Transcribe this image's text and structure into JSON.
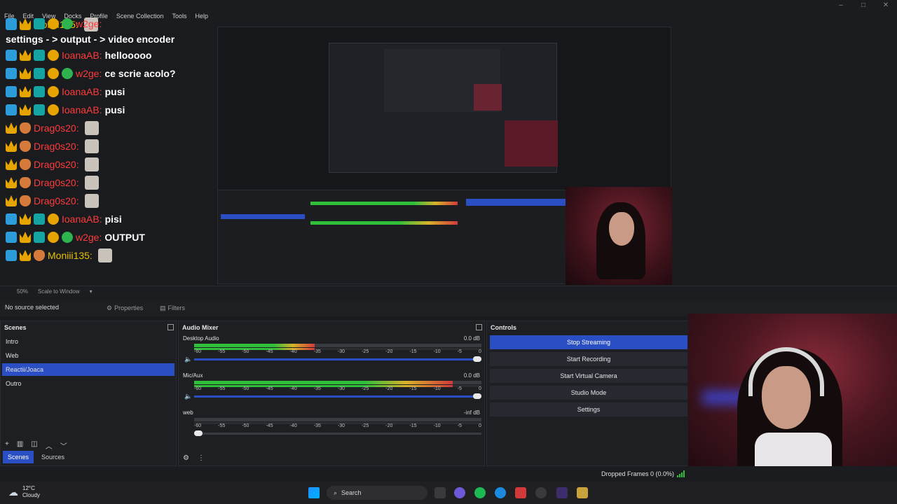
{
  "menu": [
    "File",
    "Edit",
    "View",
    "Docks",
    "Profile",
    "Scene Collection",
    "Tools",
    "Help"
  ],
  "chat": [
    {
      "user": "Moniii135:",
      "text": "",
      "color": "#e6c200",
      "badges": [
        "mod",
        "crown"
      ],
      "emote": true
    },
    {
      "user": "w2ge:",
      "text": "settings - > output - > video encoder",
      "color": "#ff3b3b",
      "badges": [
        "mod",
        "crown",
        "sub",
        "coin",
        "verify"
      ],
      "emote": false
    },
    {
      "user": "IoanaAB:",
      "text": "hellooooo",
      "color": "#ff3b3b",
      "badges": [
        "mod",
        "crown",
        "sub",
        "coin"
      ],
      "emote": false
    },
    {
      "user": "w2ge:",
      "text": "ce scrie acolo?",
      "color": "#ff3b3b",
      "badges": [
        "mod",
        "crown",
        "sub",
        "coin",
        "verify"
      ],
      "emote": false
    },
    {
      "user": "IoanaAB:",
      "text": "pusi",
      "color": "#ff3b3b",
      "badges": [
        "mod",
        "crown",
        "sub",
        "coin"
      ],
      "emote": false
    },
    {
      "user": "IoanaAB:",
      "text": "pusi",
      "color": "#ff3b3b",
      "badges": [
        "mod",
        "crown",
        "sub",
        "coin"
      ],
      "emote": false
    },
    {
      "user": "Drag0s20:",
      "text": "",
      "color": "#ff3b3b",
      "badges": [
        "crown",
        "cat"
      ],
      "emote": true
    },
    {
      "user": "Drag0s20:",
      "text": "",
      "color": "#ff3b3b",
      "badges": [
        "crown",
        "cat"
      ],
      "emote": true
    },
    {
      "user": "Drag0s20:",
      "text": "",
      "color": "#ff3b3b",
      "badges": [
        "crown",
        "cat"
      ],
      "emote": true
    },
    {
      "user": "Drag0s20:",
      "text": "",
      "color": "#ff3b3b",
      "badges": [
        "crown",
        "cat"
      ],
      "emote": true
    },
    {
      "user": "Drag0s20:",
      "text": "",
      "color": "#ff3b3b",
      "badges": [
        "crown",
        "cat"
      ],
      "emote": true
    },
    {
      "user": "IoanaAB:",
      "text": "pisi",
      "color": "#ff3b3b",
      "badges": [
        "mod",
        "crown",
        "sub",
        "coin"
      ],
      "emote": false
    },
    {
      "user": "w2ge:",
      "text": "OUTPUT",
      "color": "#ff3b3b",
      "badges": [
        "mod",
        "crown",
        "sub",
        "coin",
        "verify"
      ],
      "emote": false
    },
    {
      "user": "Moniii135:",
      "text": "",
      "color": "#e6c200",
      "badges": [
        "mod",
        "crown",
        "cat"
      ],
      "emote": true
    }
  ],
  "preview_bar": {
    "zoom": "50%",
    "scale_mode": "Scale to Window"
  },
  "source_toolbar": {
    "no_source": "No source selected",
    "properties": "Properties",
    "filters": "Filters"
  },
  "scenes": {
    "title": "Scenes",
    "items": [
      "Intro",
      "Web",
      "Reactii/Joaca",
      "Outro"
    ],
    "selected_index": 2
  },
  "tabs": [
    "Scenes",
    "Sources"
  ],
  "mixer": {
    "title": "Audio Mixer",
    "channels": [
      {
        "name": "Desktop Audio",
        "db": "0.0 dB",
        "level": 0.42,
        "peak_color": "#2fbf3a",
        "volume": 1.0,
        "active": true
      },
      {
        "name": "Mic/Aux",
        "db": "0.0 dB",
        "level": 0.9,
        "peak_color": "#e04a4a",
        "volume": 1.0,
        "active": true
      },
      {
        "name": "web",
        "db": "-inf dB",
        "level": 0.0,
        "peak_color": "#3a3b40",
        "volume": 0.0,
        "active": false
      }
    ],
    "ticks": [
      "-60",
      "-55",
      "-50",
      "-45",
      "-40",
      "-35",
      "-30",
      "-25",
      "-20",
      "-15",
      "-10",
      "-5",
      "0"
    ]
  },
  "controls": {
    "title": "Controls",
    "buttons": [
      "Stop Streaming",
      "Start Recording",
      "Start Virtual Camera",
      "Studio Mode",
      "Settings"
    ]
  },
  "status": {
    "dropped_frames": "Dropped Frames 0 (0.0%)"
  },
  "taskbar": {
    "temperature": "12°C",
    "condition": "Cloudy",
    "search": "Search"
  },
  "colors": {
    "accent": "#2a4ec4",
    "meter_green": "#2fbf3a",
    "meter_yellow": "#d8b22a",
    "meter_red": "#d23a3a"
  }
}
